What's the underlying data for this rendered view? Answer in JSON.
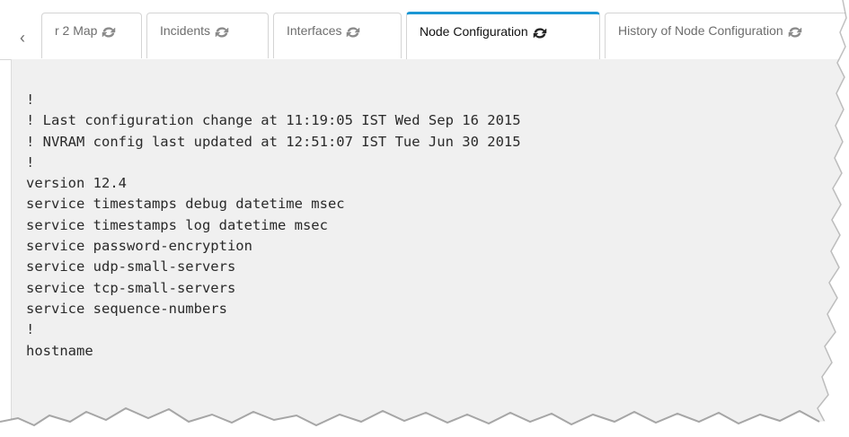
{
  "tabs": {
    "scroll_left_glyph": "‹",
    "items": [
      {
        "label": "r 2 Map",
        "active": false
      },
      {
        "label": "Incidents",
        "active": false
      },
      {
        "label": "Interfaces",
        "active": false
      },
      {
        "label": "Node Configuration",
        "active": true
      },
      {
        "label": "History of Node Configuration",
        "active": false
      }
    ],
    "refresh_icon": "refresh-icon"
  },
  "config": {
    "lines": [
      "!",
      "! Last configuration change at 11:19:05 IST Wed Sep 16 2015",
      "! NVRAM config last updated at 12:51:07 IST Tue Jun 30 2015",
      "!",
      "version 12.4",
      "service timestamps debug datetime msec",
      "service timestamps log datetime msec",
      "service password-encryption",
      "service udp-small-servers",
      "service tcp-small-servers",
      "service sequence-numbers",
      "!",
      "hostname"
    ]
  },
  "colors": {
    "active_tab_accent": "#1b97d4",
    "content_background": "#f0f0f0"
  }
}
